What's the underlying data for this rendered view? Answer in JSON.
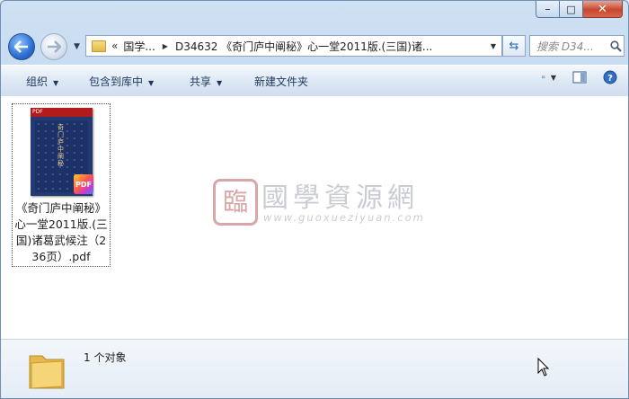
{
  "window": {
    "minimize_glyph": "–",
    "maximize_glyph": "□",
    "close_glyph": "✕"
  },
  "nav": {
    "address_overflow": "«",
    "breadcrumb_root": "国学...",
    "breadcrumb_current": "D34632 《奇门庐中阐秘》心一堂2011版.(三国)诸...",
    "search_placeholder": "搜索 D34..."
  },
  "toolbar": {
    "organize": "组织",
    "include_in_library": "包含到库中",
    "share": "共享",
    "new_folder": "新建文件夹"
  },
  "file": {
    "name": "《奇门庐中阐秘》心一堂2011版.(三国)诸葛武候注（236页）.pdf",
    "badge": "PDF",
    "cover_tag": "PDF",
    "cover_title": "奇门庐中阐秘"
  },
  "watermark": {
    "seal_char": "臨",
    "title": "國學資源網",
    "url": "www.guoxueziyuan.com"
  },
  "status": {
    "item_count": "1 个对象"
  },
  "colors": {
    "accent": "#2a6fd1",
    "close": "#c9462c",
    "watermark": "#c9cdd3",
    "seal": "#d9a6a6"
  }
}
